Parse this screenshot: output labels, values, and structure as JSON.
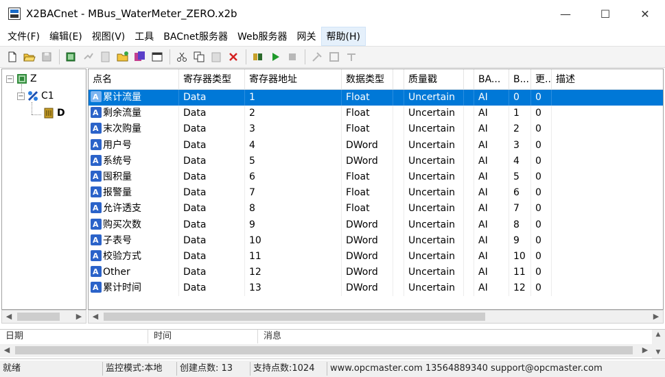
{
  "window": {
    "title": "X2BACnet - MBus_WaterMeter_ZERO.x2b",
    "minimize": "—",
    "maximize": "☐",
    "close": "✕"
  },
  "menu": [
    "文件(F)",
    "编辑(E)",
    "视图(V)",
    "工具",
    "BACnet服务器",
    "Web服务器",
    "网关",
    "帮助(H)"
  ],
  "tree": {
    "root": "Z",
    "channel": "C1",
    "device": "D"
  },
  "grid": {
    "columns": [
      "点名",
      "寄存器类型",
      "寄存器地址",
      "数据类型",
      "",
      "质量戳",
      "",
      "BA...",
      "B...",
      "更...",
      "描述"
    ],
    "rows": [
      {
        "name": "累计流量",
        "reg_type": "Data",
        "address": "1",
        "data_type": "Float",
        "quality": "Uncertain",
        "ba": "AI",
        "b": "0",
        "upd": "0",
        "desc": ""
      },
      {
        "name": "剩余流量",
        "reg_type": "Data",
        "address": "2",
        "data_type": "Float",
        "quality": "Uncertain",
        "ba": "AI",
        "b": "1",
        "upd": "0",
        "desc": ""
      },
      {
        "name": "末次购量",
        "reg_type": "Data",
        "address": "3",
        "data_type": "Float",
        "quality": "Uncertain",
        "ba": "AI",
        "b": "2",
        "upd": "0",
        "desc": ""
      },
      {
        "name": "用户号",
        "reg_type": "Data",
        "address": "4",
        "data_type": "DWord",
        "quality": "Uncertain",
        "ba": "AI",
        "b": "3",
        "upd": "0",
        "desc": ""
      },
      {
        "name": "系统号",
        "reg_type": "Data",
        "address": "5",
        "data_type": "DWord",
        "quality": "Uncertain",
        "ba": "AI",
        "b": "4",
        "upd": "0",
        "desc": ""
      },
      {
        "name": "囤积量",
        "reg_type": "Data",
        "address": "6",
        "data_type": "Float",
        "quality": "Uncertain",
        "ba": "AI",
        "b": "5",
        "upd": "0",
        "desc": ""
      },
      {
        "name": "报警量",
        "reg_type": "Data",
        "address": "7",
        "data_type": "Float",
        "quality": "Uncertain",
        "ba": "AI",
        "b": "6",
        "upd": "0",
        "desc": ""
      },
      {
        "name": "允许透支",
        "reg_type": "Data",
        "address": "8",
        "data_type": "Float",
        "quality": "Uncertain",
        "ba": "AI",
        "b": "7",
        "upd": "0",
        "desc": ""
      },
      {
        "name": "购买次数",
        "reg_type": "Data",
        "address": "9",
        "data_type": "DWord",
        "quality": "Uncertain",
        "ba": "AI",
        "b": "8",
        "upd": "0",
        "desc": ""
      },
      {
        "name": "子表号",
        "reg_type": "Data",
        "address": "10",
        "data_type": "DWord",
        "quality": "Uncertain",
        "ba": "AI",
        "b": "9",
        "upd": "0",
        "desc": ""
      },
      {
        "name": "校验方式",
        "reg_type": "Data",
        "address": "11",
        "data_type": "DWord",
        "quality": "Uncertain",
        "ba": "AI",
        "b": "10",
        "upd": "0",
        "desc": ""
      },
      {
        "name": "Other",
        "reg_type": "Data",
        "address": "12",
        "data_type": "DWord",
        "quality": "Uncertain",
        "ba": "AI",
        "b": "11",
        "upd": "0",
        "desc": ""
      },
      {
        "name": "累计时间",
        "reg_type": "Data",
        "address": "13",
        "data_type": "DWord",
        "quality": "Uncertain",
        "ba": "AI",
        "b": "12",
        "upd": "0",
        "desc": ""
      }
    ],
    "selected_row": 0
  },
  "log": {
    "columns": [
      "日期",
      "时间",
      "消息"
    ]
  },
  "status": {
    "ready": "就绪",
    "mode": "监控模式:本地",
    "created": "创建点数:  13",
    "supported": "支持点数:1024",
    "contact": "www.opcmaster.com 13564889340 support@opcmaster.com"
  },
  "colors": {
    "selection": "#0078d7",
    "point_icon": "#2b63c9"
  }
}
